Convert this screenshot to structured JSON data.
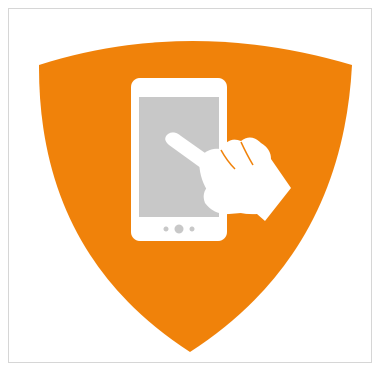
{
  "icon": {
    "name": "mobile-touch-shield-icon",
    "shield_color": "#F0820A",
    "phone_color": "#FFFFFF",
    "screen_color": "#C8C8C8",
    "hand_color": "#FFFFFF"
  }
}
